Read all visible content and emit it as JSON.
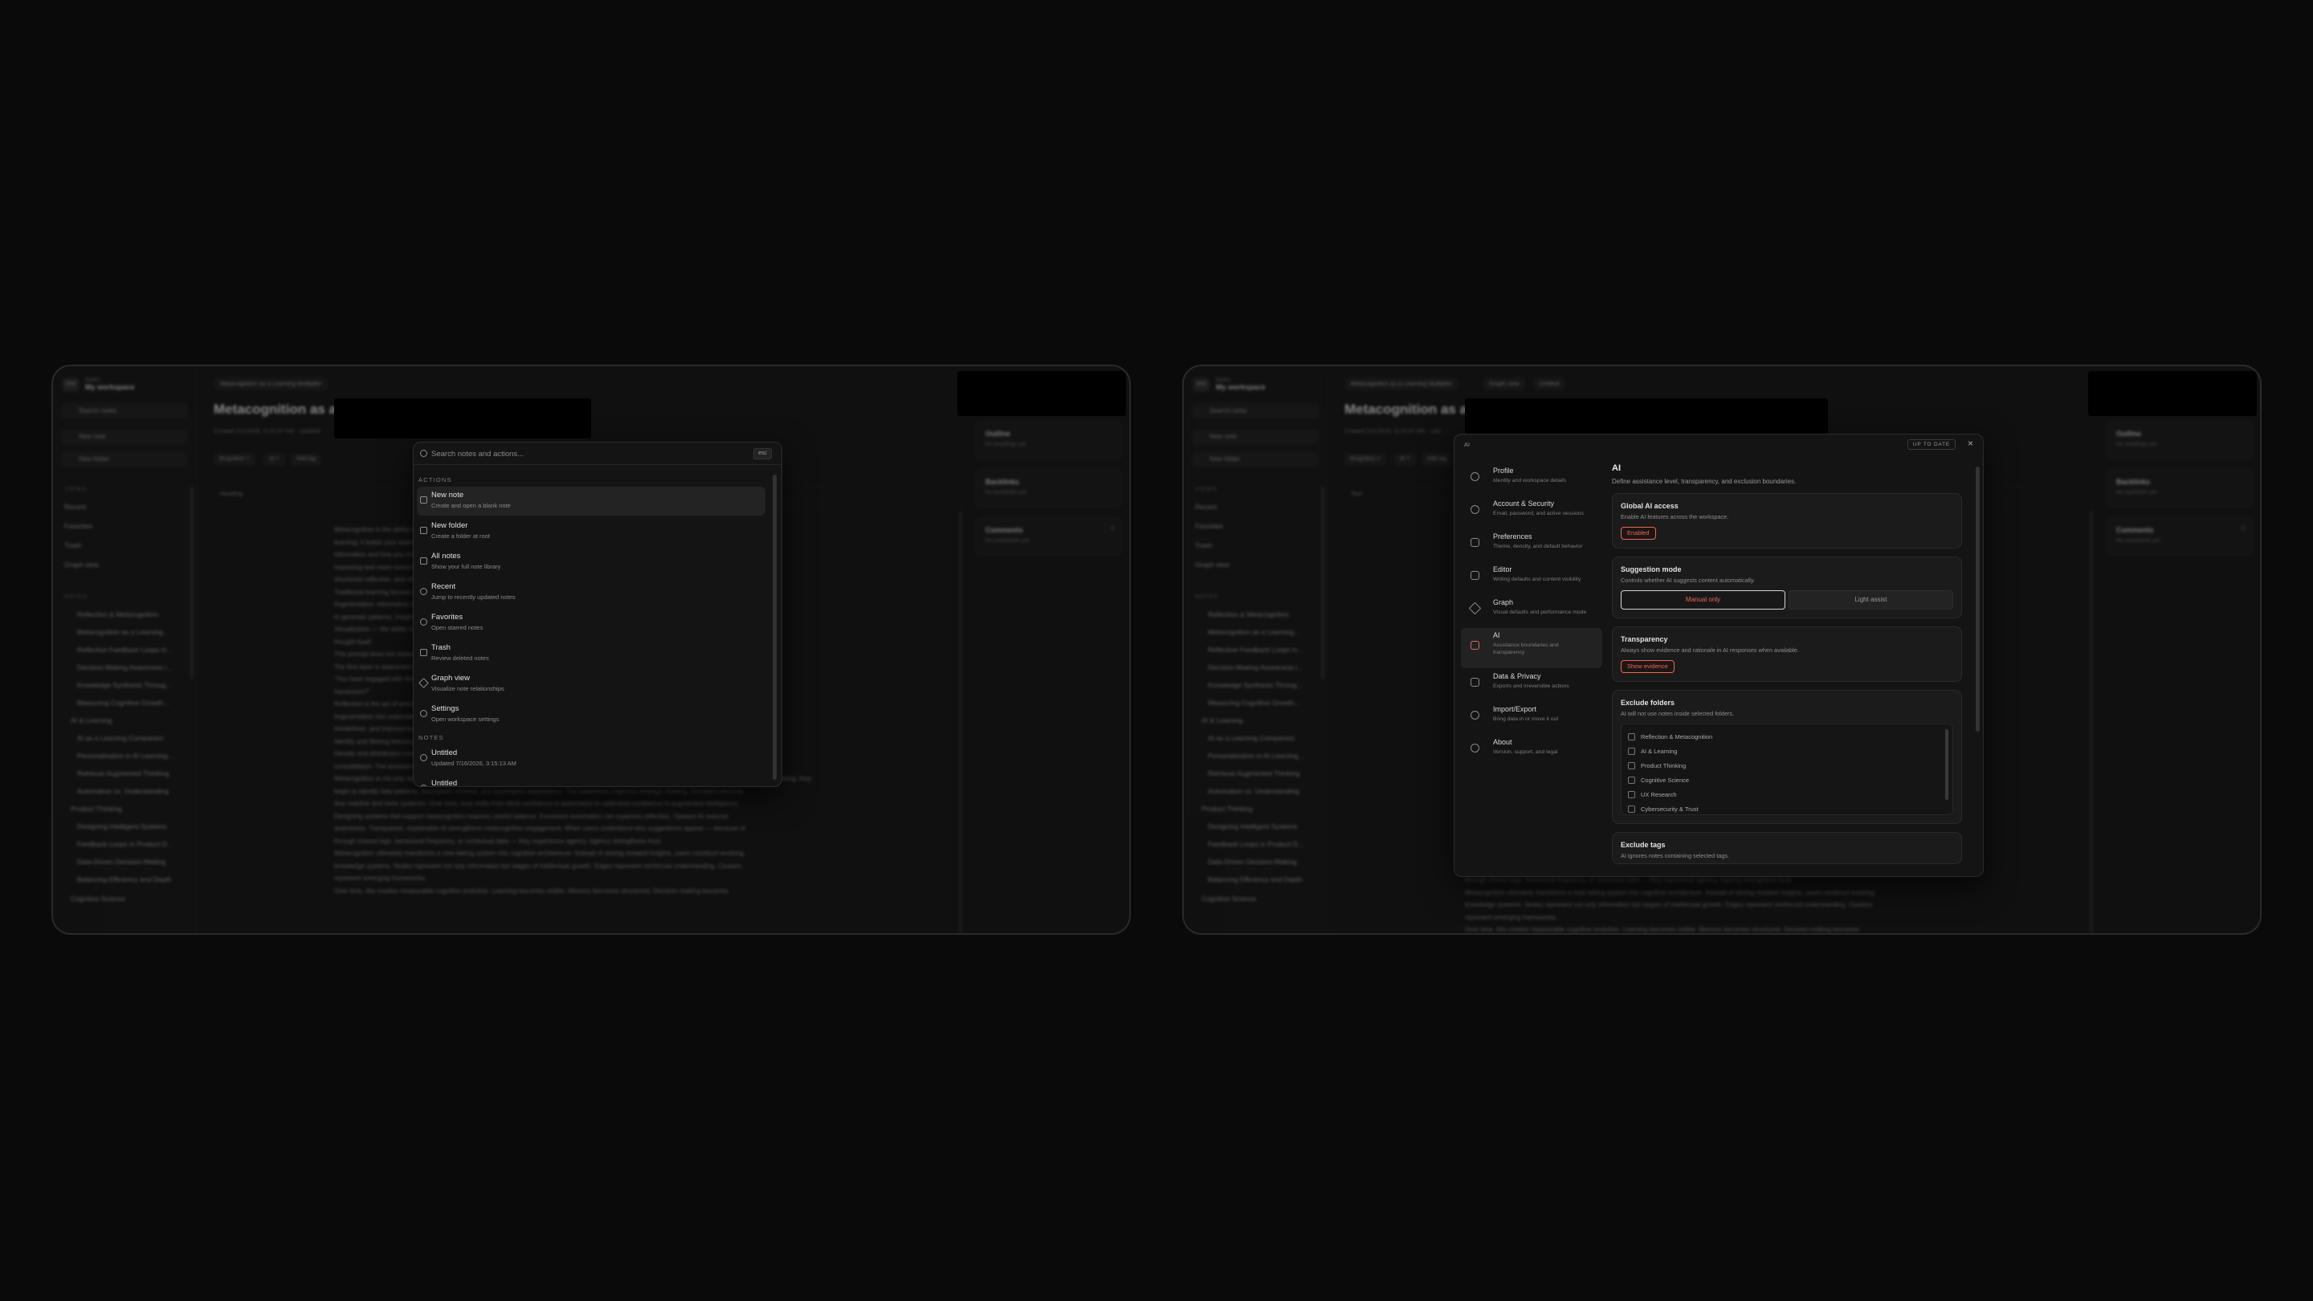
{
  "left": {
    "workspace": {
      "initials": "MW",
      "label": "Notes",
      "name": "My workspace"
    },
    "sidebar": {
      "search": "Search notes",
      "new_note": "New note",
      "new_folder": "New folder",
      "views_label": "VIEWS",
      "views": [
        "Recent",
        "Favorites",
        "Trash",
        "Graph view"
      ],
      "notes_label": "NOTES",
      "tree": [
        "Reflection & Metacognition",
        "Metacognition as a Learning…",
        "Reflective Feedback Loops in…",
        "Decision-Making Awareness i…",
        "Knowledge Synthesis Throug…",
        "Measuring Cognitive Growth…",
        "AI & Learning",
        "AI as a Learning Companion",
        "Personalization in AI Learning…",
        "Retrieval-Augmented Thinking",
        "Automation vs. Understanding",
        "Product Thinking",
        "Designing Intelligent Systems",
        "Feedback Loops in Product D…",
        "Data-Driven Decision-Making",
        "Balancing Efficiency and Depth",
        "Cognitive Science"
      ]
    },
    "header": {
      "tab": "Metacognition as a Learning Multiplier",
      "title": "Metacognition as a L",
      "meta": "Created 2/11/2026, 11:41:07 AM · Updated"
    },
    "chips": [
      "Brognition ×",
      "AI ×",
      "Add tag"
    ],
    "toolbar": {
      "style": "Heading"
    },
    "body": [
      "Metacognition is the ability to think about thinking. It is the process of",
      "learning: it builds your awareness of how you understand, how you retain",
      "information and how you make decisions. When developed intentionally,",
      "reasoning and more conscious decision-making. This note explores",
      "structured reflection, and why metacognition becomes increasingly",
      "Traditional learning focuses on content: memorize, repeat, recall",
      "fragmentation: information accumulates but is rarely connected",
      "to generate patterns, insights and meaning. The process becomes",
      "Visualization — the ability to see how ideas relate to each other",
      "thought itself.",
      "This prompt does not replace learning; it adds structure to",
      "The first layer is awareness: noticing which methods work",
      "\"You have engaged with this note several times this week\"",
      "framework?\"",
      "Reflection is the act of processing experience. It converts",
      "fragmentation into understanding, patterns into insight",
      "breakdown, and improvement strategies.",
      "Identity and lifelong learning — the habit of recognizing",
      "Density and distribution create connections. When all highlights share strengthening connections, users discover hidden links",
      "consolidation. The assistant further reinforces learning — creating a feedback loop between memory, reflection, and behavioral alignment.",
      "Metacognition is not only about learning. It directly influences decision-making quality. When individuals reflect on how previous notes influenced current reasoning, they",
      "begin to identify bias patterns, incomplete retrieval, and assumption dependency. The awareness improves strategic thinking. Decisions become",
      "less reactive and more systemic. Over time, trust shifts from blind confidence in automation to calibrated confidence in augmented intelligence.",
      "Designing systems that support metacognition requires careful balance. Excessive automation can suppress reflection. Opaque AI reduces",
      "awareness. Transparent, explainable AI strengthens metacognitive engagement. When users understand why suggestions appear — because of",
      "through shared tags, behavioral frequency, or contextual data — they experience agency. Agency strengthens trust.",
      "Metacognition ultimately transforms a note-taking system into cognitive architecture. Instead of storing isolated insights, users construct evolving",
      "knowledge systems. Nodes represent not only information but stages of intellectual growth. Edges represent reinforced understanding. Clusters",
      "represent emerging frameworks.",
      "Over time, this creates measurable cognitive evolution. Learning becomes visible. Memory becomes structured. Decision-making becomes"
    ],
    "right_panel": [
      {
        "title": "Outline",
        "sub": "No headings yet"
      },
      {
        "title": "Backlinks",
        "sub": "No backlinks yet"
      },
      {
        "title": "Comments",
        "sub": "No comments yet",
        "count": "0"
      }
    ],
    "palette": {
      "placeholder": "Search notes and actions...",
      "shortcut": "esc",
      "actions_label": "ACTIONS",
      "actions": [
        {
          "title": "New note",
          "sub": "Create and open a blank note",
          "icon": "plus-icon"
        },
        {
          "title": "New folder",
          "sub": "Create a folder at root",
          "icon": "folder-icon"
        },
        {
          "title": "All notes",
          "sub": "Show your full note library",
          "icon": "notes-icon"
        },
        {
          "title": "Recent",
          "sub": "Jump to recently updated notes",
          "icon": "clock-icon"
        },
        {
          "title": "Favorites",
          "sub": "Open starred notes",
          "icon": "star-icon"
        },
        {
          "title": "Trash",
          "sub": "Review deleted notes",
          "icon": "trash-icon"
        },
        {
          "title": "Graph view",
          "sub": "Visualize note relationships",
          "icon": "graph-icon"
        },
        {
          "title": "Settings",
          "sub": "Open workspace settings",
          "icon": "gear-icon"
        }
      ],
      "notes_label": "NOTES",
      "notes": [
        {
          "title": "Untitled",
          "sub": "Updated 7/16/2026, 3:15:13 AM"
        },
        {
          "title": "Untitled",
          "sub": ""
        }
      ]
    }
  },
  "right": {
    "workspace": {
      "initials": "MW",
      "label": "Notes",
      "name": "My workspace"
    },
    "sidebar": {
      "search": "Search notes",
      "new_note": "New note",
      "new_folder": "New folder",
      "views_label": "VIEWS",
      "views": [
        "Recent",
        "Favorites",
        "Trash",
        "Graph view"
      ],
      "notes_label": "NOTES",
      "tree": [
        "Reflection & Metacognition",
        "Metacognition as a Learning…",
        "Reflective Feedback Loops in…",
        "Decision-Making Awareness i…",
        "Knowledge Synthesis Throug…",
        "Measuring Cognitive Growth…",
        "AI & Learning",
        "AI as a Learning Companion",
        "Personalization in AI Learning…",
        "Retrieval-Augmented Thinking",
        "Automation vs. Understanding",
        "Product Thinking",
        "Designing Intelligent Systems",
        "Feedback Loops in Product D…",
        "Data-Driven Decision-Making",
        "Balancing Efficiency and Depth",
        "Cognitive Science"
      ]
    },
    "header": {
      "tab": "Metacognition as a Learning Multiplier",
      "tab2": "Graph view",
      "tab3": "Untitled",
      "title": "Metacognition as a L",
      "meta": "Created 2/11/2026, 11:41:07 AM · Last"
    },
    "chips": [
      "Brognition ×",
      "AI ×",
      "Add tag"
    ],
    "toolbar": {
      "style": "Text"
    },
    "body": [
      "through shared tags, behavioral frequency, or contextual data — they experience agency. Agency strengthens trust.",
      "Metacognition ultimately transforms a note-taking system into cognitive architecture. Instead of storing isolated insights, users construct evolving",
      "knowledge systems. Nodes represent not only information but stages of intellectual growth. Edges represent reinforced understanding. Clusters",
      "represent emerging frameworks.",
      "Over time, this creates measurable cognitive evolution. Learning becomes visible. Memory becomes structured. Decision-making becomes"
    ],
    "right_panel": [
      {
        "title": "Outline",
        "sub": "No headings yet"
      },
      {
        "title": "Backlinks",
        "sub": "No backlinks yet"
      },
      {
        "title": "Comments",
        "sub": "No comments yet",
        "count": "0"
      }
    ],
    "settings": {
      "crumb": "AI",
      "status": "UP TO DATE",
      "close": "×",
      "nav": [
        {
          "title": "Profile",
          "sub": "Identity and workspace details",
          "icon": "user-icon"
        },
        {
          "title": "Account & Security",
          "sub": "Email, password, and active sessions",
          "icon": "shield-icon"
        },
        {
          "title": "Preferences",
          "sub": "Theme, density, and default behavior",
          "icon": "sliders-icon"
        },
        {
          "title": "Editor",
          "sub": "Writing defaults and content visibility",
          "icon": "pen-icon"
        },
        {
          "title": "Graph",
          "sub": "Visual defaults and performance mode",
          "icon": "graph-icon"
        },
        {
          "title": "AI",
          "sub": "Assistance boundaries and transparency",
          "icon": "sparkle-icon"
        },
        {
          "title": "Data & Privacy",
          "sub": "Exports and irreversible actions",
          "icon": "lock-icon"
        },
        {
          "title": "Import/Export",
          "sub": "Bring data in or move it out",
          "icon": "swap-icon"
        },
        {
          "title": "About",
          "sub": "Version, support, and legal",
          "icon": "info-icon"
        }
      ],
      "title": "AI",
      "desc": "Define assistance level, transparency, and exclusion boundaries.",
      "global": {
        "title": "Global AI access",
        "sub": "Enable AI features across the workspace.",
        "button": "Enabled"
      },
      "suggest": {
        "title": "Suggestion mode",
        "sub": "Controls whether AI suggests content automatically.",
        "opt1": "Manual only",
        "opt2": "Light assist"
      },
      "transparency": {
        "title": "Transparency",
        "sub": "Always show evidence and rationale in AI responses when available.",
        "button": "Show evidence"
      },
      "exclude_folders": {
        "title": "Exclude folders",
        "sub": "AI will not use notes inside selected folders.",
        "items": [
          "Reflection & Metacognition",
          "AI & Learning",
          "Product Thinking",
          "Cognitive Science",
          "UX Research",
          "Cybersecurity & Trust"
        ]
      },
      "exclude_tags": {
        "title": "Exclude tags",
        "sub": "AI ignores notes containing selected tags."
      }
    }
  },
  "colors": {
    "accent": "#e26a5a",
    "background": "#0a0a0a",
    "panel": "#141414"
  }
}
